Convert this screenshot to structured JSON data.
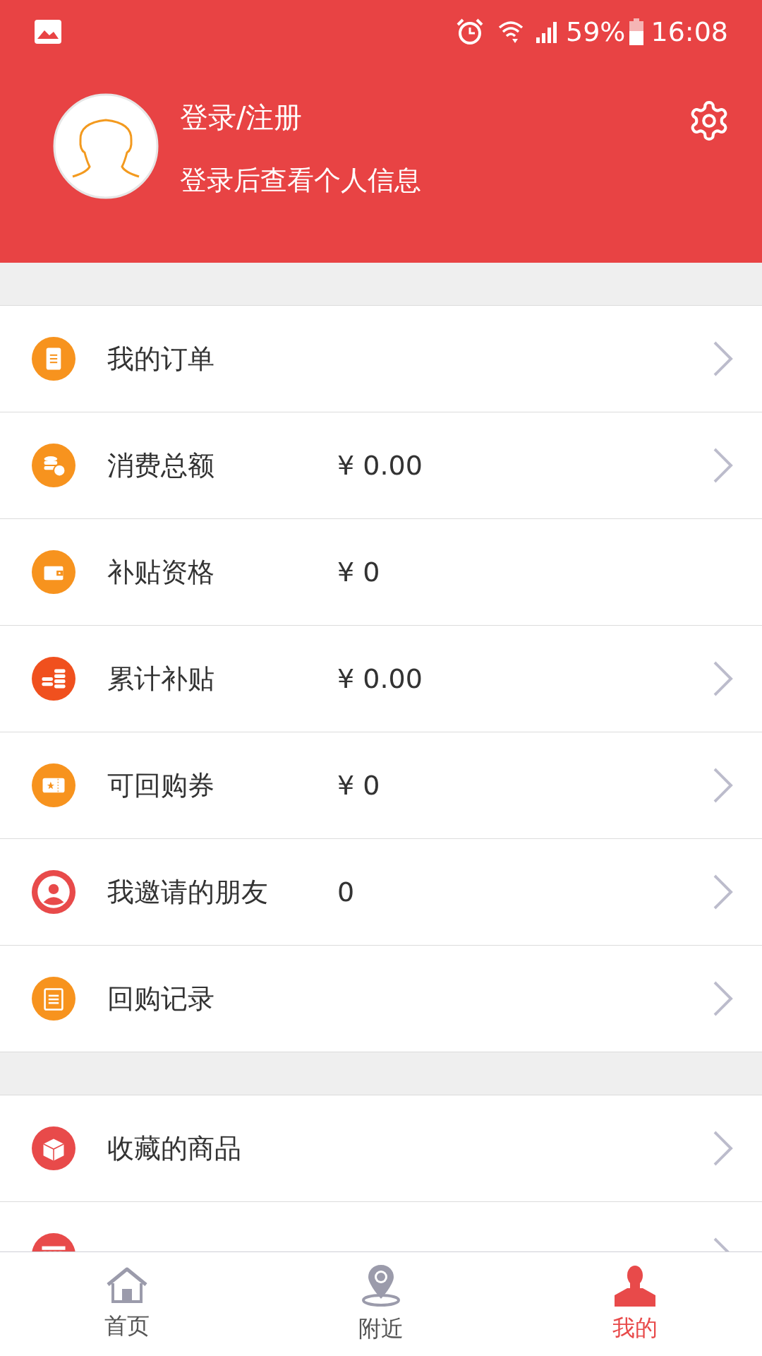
{
  "status_bar": {
    "battery": "59%",
    "time": "16:08"
  },
  "profile": {
    "title": "登录/注册",
    "subtitle": "登录后查看个人信息"
  },
  "menu_groups": [
    {
      "items": [
        {
          "kind": "order",
          "label": "我的订单",
          "has_arrow": true
        },
        {
          "kind": "coins-dollar",
          "label": "消费总额",
          "value": "¥ 0.00",
          "has_arrow": true
        },
        {
          "kind": "wallet",
          "label": "补贴资格",
          "value": "¥ 0",
          "has_arrow": false
        },
        {
          "kind": "coins",
          "label": "累计补贴",
          "value": "¥ 0.00",
          "has_arrow": true
        },
        {
          "kind": "ticket",
          "label": "可回购券",
          "value": "¥ 0",
          "has_arrow": true
        },
        {
          "kind": "person",
          "label": "我邀请的朋友",
          "value": "0",
          "has_arrow": true
        },
        {
          "kind": "notepad",
          "label": "回购记录",
          "has_arrow": true
        }
      ]
    },
    {
      "items": [
        {
          "kind": "box",
          "label": "收藏的商品",
          "has_arrow": true
        },
        {
          "kind": "shop",
          "has_arrow": true
        }
      ]
    }
  ],
  "bottom_nav": [
    {
      "kind": "home",
      "label": "首页",
      "selected": false
    },
    {
      "kind": "pin",
      "label": "附近",
      "selected": false
    },
    {
      "kind": "user",
      "label": "我的",
      "selected": true
    }
  ]
}
